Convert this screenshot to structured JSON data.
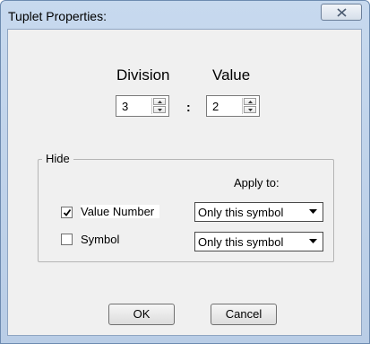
{
  "window": {
    "title": "Tuplet Properties:"
  },
  "headers": {
    "division": "Division",
    "value": "Value"
  },
  "division_spinner": {
    "value": "3"
  },
  "separator": ":",
  "value_spinner": {
    "value": "2"
  },
  "hide_group": {
    "title": "Hide",
    "apply_to_label": "Apply to:",
    "rows": [
      {
        "label": "Value Number",
        "checked": true,
        "apply_to": "Only this symbol"
      },
      {
        "label": "Symbol",
        "checked": false,
        "apply_to": "Only this symbol"
      }
    ]
  },
  "buttons": {
    "ok": "OK",
    "cancel": "Cancel"
  }
}
